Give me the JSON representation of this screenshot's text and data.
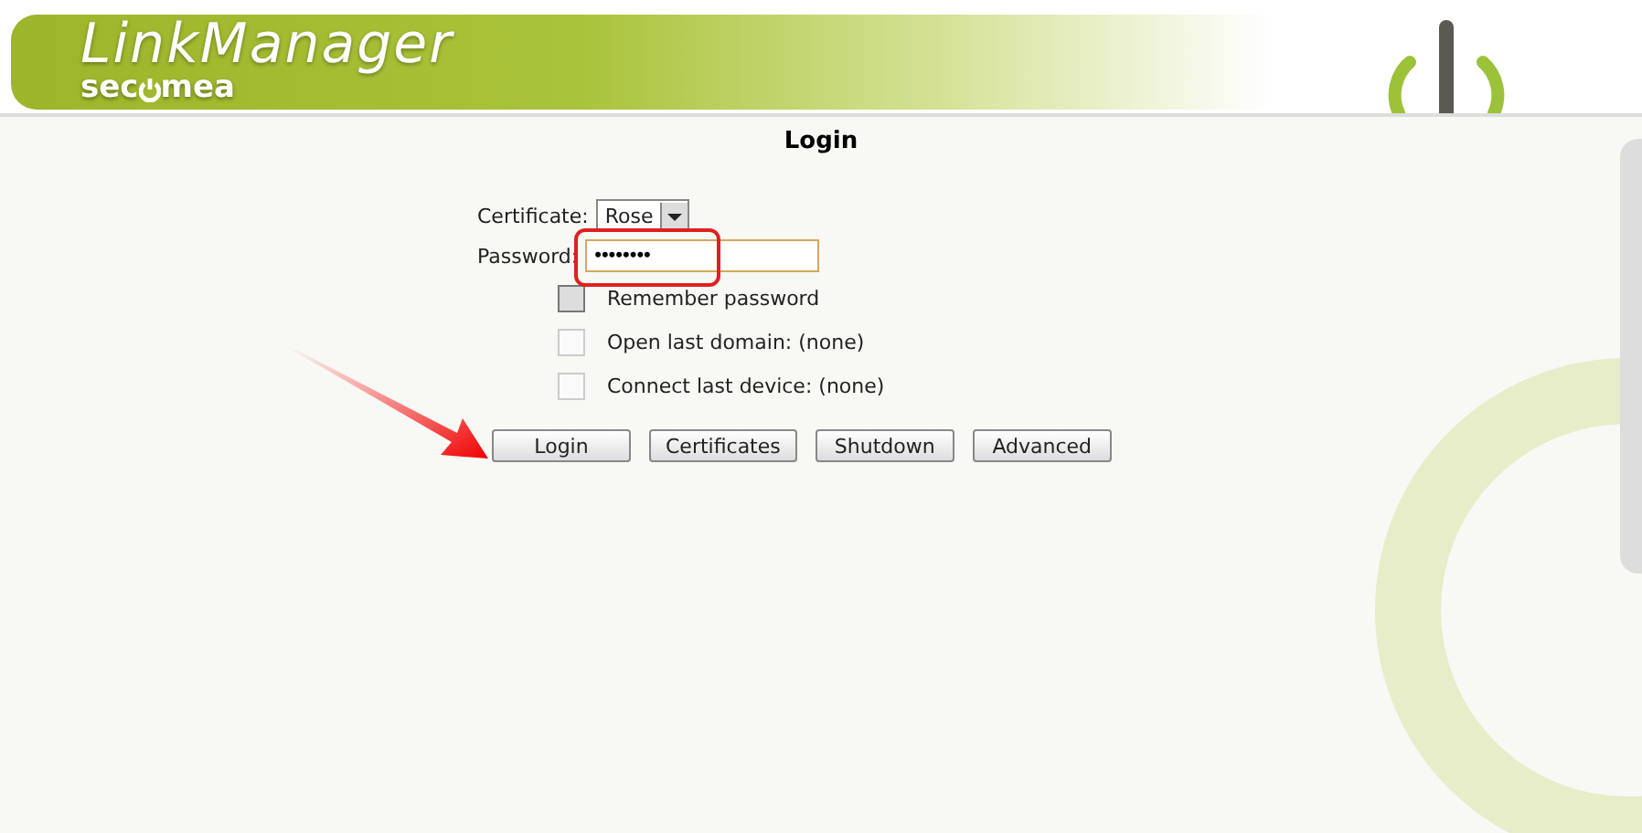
{
  "header": {
    "product": "LinkManager",
    "brand_parts": [
      "sec",
      "mea"
    ]
  },
  "title": "Login",
  "form": {
    "certificate": {
      "label": "Certificate:",
      "value": "Rose"
    },
    "password": {
      "label": "Password:",
      "value": "••••••••",
      "highlighted": true
    },
    "options": [
      {
        "label": "Remember password",
        "checked": false,
        "disabled": false
      },
      {
        "label": "Open last domain: (none)",
        "checked": false,
        "disabled": true
      },
      {
        "label": "Connect last device: (none)",
        "checked": false,
        "disabled": true
      }
    ]
  },
  "buttons": [
    "Login",
    "Certificates",
    "Shutdown",
    "Advanced"
  ]
}
